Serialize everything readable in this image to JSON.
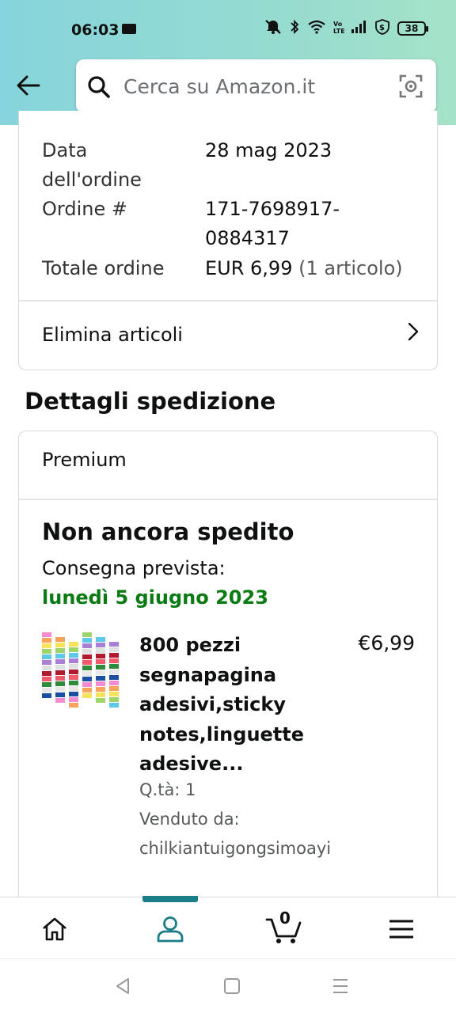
{
  "status_bar": {
    "time": "06:03",
    "battery": "38"
  },
  "search": {
    "placeholder": "Cerca su Amazon.it"
  },
  "order_summary": {
    "rows": [
      {
        "label": "Data dell'ordine",
        "value": "28 mag 2023"
      },
      {
        "label": "Ordine #",
        "value": "171-7698917-0884317"
      },
      {
        "label": "Totale ordine",
        "value_main": "EUR 6,99",
        "value_muted": "(1 articolo)"
      }
    ],
    "delete_link": "Elimina articoli"
  },
  "shipping": {
    "section_title": "Dettagli spedizione",
    "type": "Premium",
    "status": "Non ancora spedito",
    "delivery_label": "Consegna prevista:",
    "delivery_date": "lunedì 5 giugno 2023",
    "product": {
      "title": "800 pezzi segnapagina adesivi,sticky notes,linguette adesive...",
      "price": "€6,99",
      "quantity": "Q.tà: 1",
      "seller_label": "Venduto da:",
      "seller": "chilkiantuigongsimoayi"
    }
  },
  "bottom_nav": {
    "cart_count": "0",
    "active": "account"
  },
  "colors": {
    "accent_teal": "#1a7d87",
    "delivery_green": "#0a7a12",
    "header_gradient_start": "#86d4dc",
    "header_gradient_end": "#a5e3c8"
  }
}
